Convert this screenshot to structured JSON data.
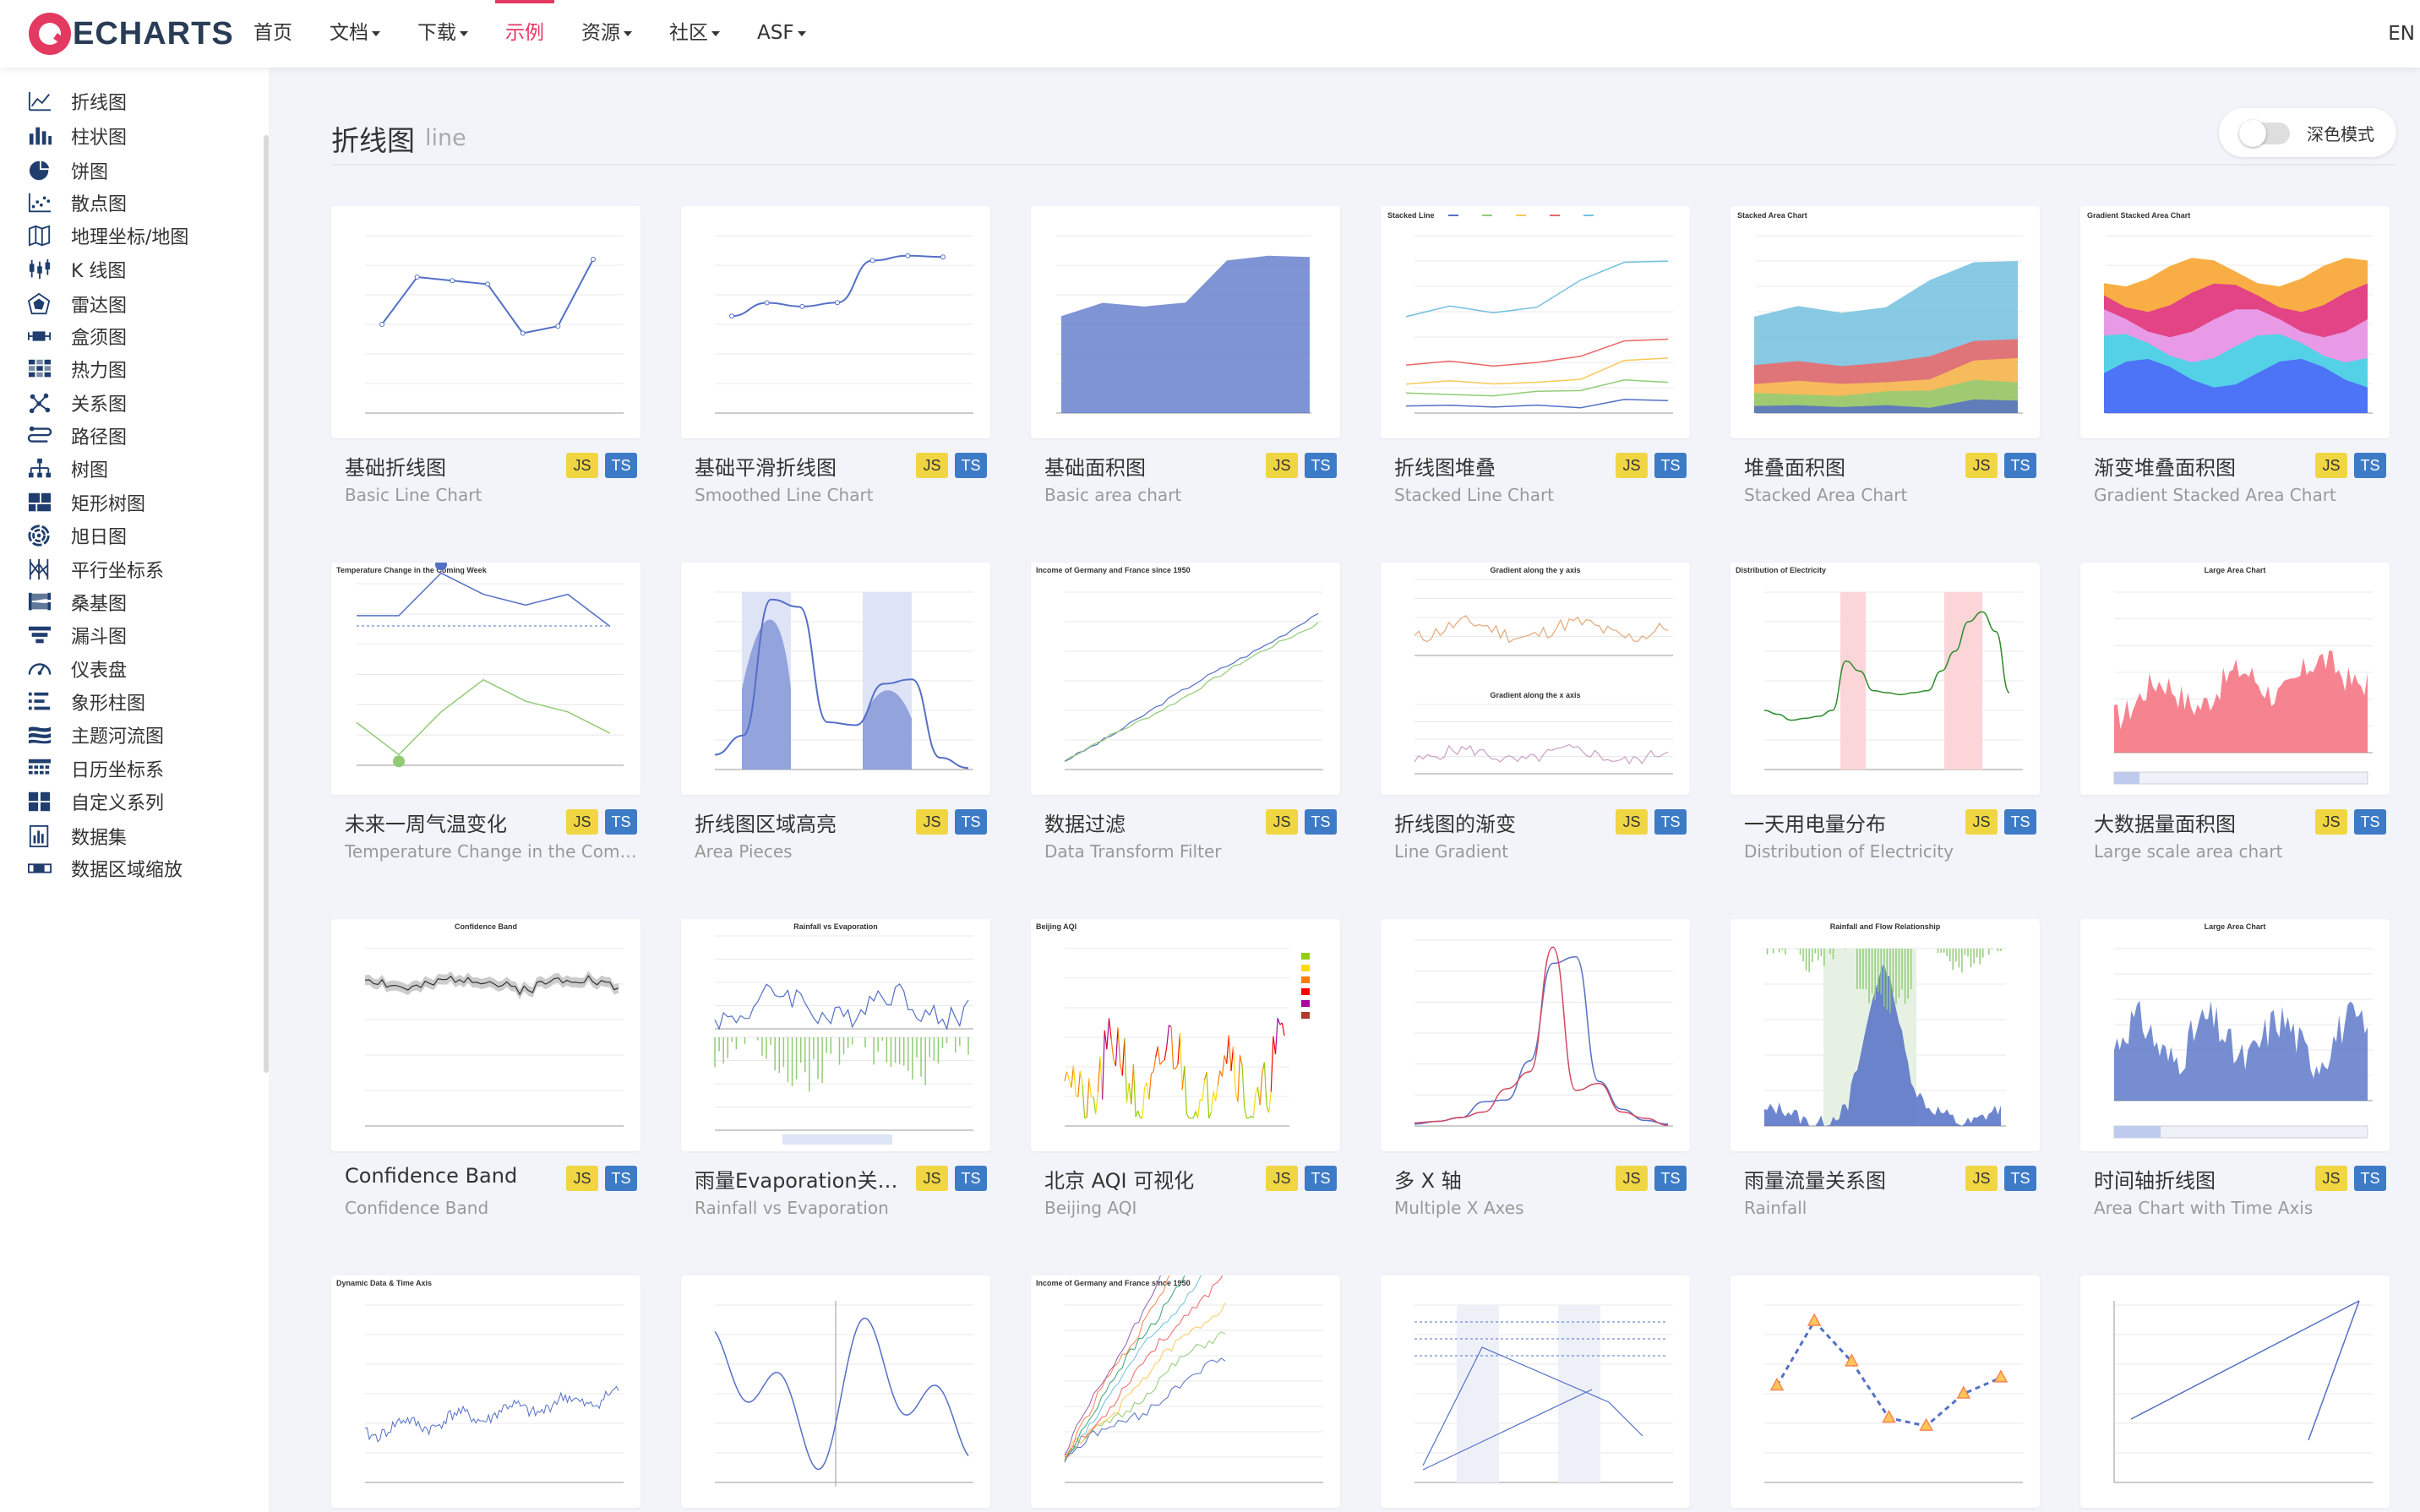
{
  "header": {
    "logo_text": "ECHARTS",
    "nav": [
      {
        "label": "首页",
        "caret": false,
        "active": false
      },
      {
        "label": "文档",
        "caret": true,
        "active": false
      },
      {
        "label": "下载",
        "caret": true,
        "active": false
      },
      {
        "label": "示例",
        "caret": false,
        "active": true
      },
      {
        "label": "资源",
        "caret": true,
        "active": false
      },
      {
        "label": "社区",
        "caret": true,
        "active": false
      },
      {
        "label": "ASF",
        "caret": true,
        "active": false
      }
    ],
    "lang": "EN"
  },
  "sidebar": {
    "items": [
      {
        "label": "折线图",
        "icon": "line-chart-icon"
      },
      {
        "label": "柱状图",
        "icon": "bar-chart-icon"
      },
      {
        "label": "饼图",
        "icon": "pie-chart-icon"
      },
      {
        "label": "散点图",
        "icon": "scatter-chart-icon"
      },
      {
        "label": "地理坐标/地图",
        "icon": "map-icon"
      },
      {
        "label": "K 线图",
        "icon": "candlestick-icon"
      },
      {
        "label": "雷达图",
        "icon": "radar-icon"
      },
      {
        "label": "盒须图",
        "icon": "boxplot-icon"
      },
      {
        "label": "热力图",
        "icon": "heatmap-icon"
      },
      {
        "label": "关系图",
        "icon": "graph-icon"
      },
      {
        "label": "路径图",
        "icon": "lines-icon"
      },
      {
        "label": "树图",
        "icon": "tree-icon"
      },
      {
        "label": "矩形树图",
        "icon": "treemap-icon"
      },
      {
        "label": "旭日图",
        "icon": "sunburst-icon"
      },
      {
        "label": "平行坐标系",
        "icon": "parallel-icon"
      },
      {
        "label": "桑基图",
        "icon": "sankey-icon"
      },
      {
        "label": "漏斗图",
        "icon": "funnel-icon"
      },
      {
        "label": "仪表盘",
        "icon": "gauge-icon"
      },
      {
        "label": "象形柱图",
        "icon": "pictorial-bar-icon"
      },
      {
        "label": "主题河流图",
        "icon": "theme-river-icon"
      },
      {
        "label": "日历坐标系",
        "icon": "calendar-icon"
      },
      {
        "label": "自定义系列",
        "icon": "custom-series-icon"
      },
      {
        "label": "数据集",
        "icon": "dataset-icon"
      },
      {
        "label": "数据区域缩放",
        "icon": "datazoom-icon"
      }
    ]
  },
  "main": {
    "title": "折线图",
    "subtitle": "line",
    "dark_mode_label": "深色模式",
    "dark_mode_on": false,
    "badges": {
      "js": "JS",
      "ts": "TS"
    },
    "cards": [
      {
        "title": "基础折线图",
        "subtitle": "Basic Line Chart",
        "thumb": "line"
      },
      {
        "title": "基础平滑折线图",
        "subtitle": "Smoothed Line Chart",
        "thumb": "smooth"
      },
      {
        "title": "基础面积图",
        "subtitle": "Basic area chart",
        "thumb": "area"
      },
      {
        "title": "折线图堆叠",
        "subtitle": "Stacked Line Chart",
        "thumb": "stacked-line"
      },
      {
        "title": "堆叠面积图",
        "subtitle": "Stacked Area Chart",
        "thumb": "stacked-area"
      },
      {
        "title": "渐变堆叠面积图",
        "subtitle": "Gradient Stacked Area Chart",
        "thumb": "gradient-stacked"
      },
      {
        "title": "未来一周气温变化",
        "subtitle": "Temperature Change in the Coming Week",
        "thumb": "temperature"
      },
      {
        "title": "折线图区域高亮",
        "subtitle": "Area Pieces",
        "thumb": "area-pieces"
      },
      {
        "title": "数据过滤",
        "subtitle": "Data Transform Filter",
        "thumb": "filter"
      },
      {
        "title": "折线图的渐变",
        "subtitle": "Line Gradient",
        "thumb": "line-gradient"
      },
      {
        "title": "一天用电量分布",
        "subtitle": "Distribution of Electricity",
        "thumb": "electricity"
      },
      {
        "title": "大数据量面积图",
        "subtitle": "Large scale area chart",
        "thumb": "large-area"
      },
      {
        "title": "Confidence Band",
        "subtitle": "Confidence Band",
        "thumb": "confidence"
      },
      {
        "title": "雨量Evaporation关系图",
        "subtitle": "Rainfall vs Evaporation",
        "thumb": "rainfall-evap"
      },
      {
        "title": "北京 AQI 可视化",
        "subtitle": "Beijing AQI",
        "thumb": "aqi"
      },
      {
        "title": "多 X 轴",
        "subtitle": "Multiple X Axes",
        "thumb": "multi-x"
      },
      {
        "title": "雨量流量关系图",
        "subtitle": "Rainfall",
        "thumb": "rainfall"
      },
      {
        "title": "时间轴折线图",
        "subtitle": "Area Chart with Time Axis",
        "thumb": "time-area"
      },
      {
        "title": "",
        "subtitle": "",
        "thumb": "dynamic"
      },
      {
        "title": "",
        "subtitle": "",
        "thumb": "function"
      },
      {
        "title": "",
        "subtitle": "",
        "thumb": "income"
      },
      {
        "title": "",
        "subtitle": "",
        "thumb": "label-pos"
      },
      {
        "title": "",
        "subtitle": "",
        "thumb": "style"
      },
      {
        "title": "",
        "subtitle": "",
        "thumb": "log"
      }
    ]
  },
  "thumb_titles": {
    "temperature": "Temperature Change in the Coming Week",
    "filter": "Income of Germany and France since 1950",
    "gradient_y": "Gradient along the y axis",
    "gradient_x": "Gradient along the x axis",
    "electricity": "Distribution of Electricity",
    "large_area": "Large Area Chart",
    "confidence": "Confidence Band",
    "rainfall_evap": "Rainfall vs Evaporation",
    "aqi": "Beijing AQI",
    "rainfall": "Rainfall and Flow Relationship",
    "dynamic": "Dynamic Data & Time Axis",
    "stacked_line": "Stacked Line",
    "stacked_area": "Stacked Area Chart",
    "gradient_stacked": "Gradient Stacked Area Chart"
  },
  "colors": {
    "accent": "#e43961",
    "blue": "#5470c6",
    "green": "#91cc75",
    "yellow": "#fac858",
    "red": "#ee6666",
    "cyan": "#73c0de",
    "teal": "#3ba272",
    "orange": "#fc8452",
    "purple": "#9a60b4"
  }
}
